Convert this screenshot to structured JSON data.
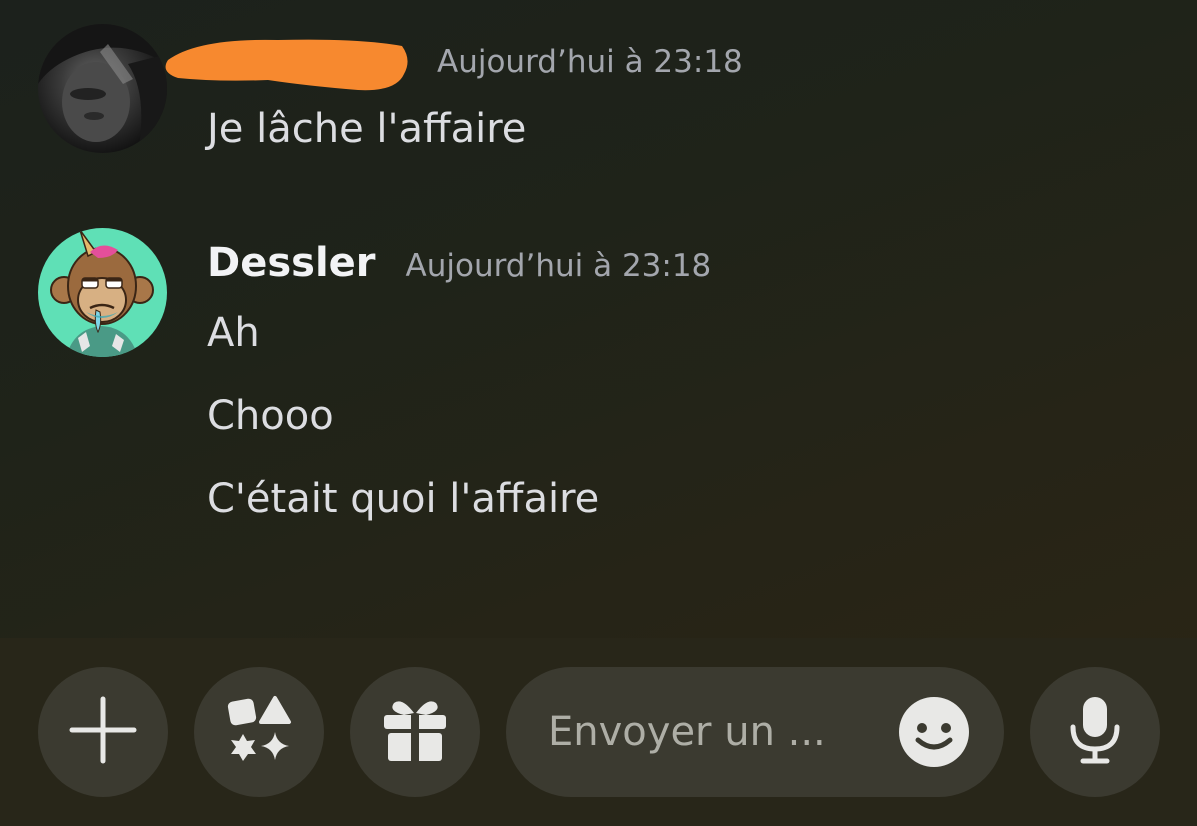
{
  "messages": [
    {
      "author": "",
      "timestamp": "Aujourd’hui à 23:18",
      "lines": [
        "Je lâche l'affaire"
      ]
    },
    {
      "author": "Dessler",
      "timestamp": "Aujourd’hui à 23:18",
      "lines": [
        "Ah",
        "Chooo",
        "C'était quoi l'affaire"
      ]
    }
  ],
  "composer": {
    "placeholder": "Envoyer un ...",
    "buttons": {
      "attach": "plus-icon",
      "apps": "apps-icon",
      "gift": "gift-icon",
      "emoji": "emoji-icon",
      "voice": "microphone-icon"
    }
  },
  "colors": {
    "redaction": "#f7892f",
    "avatar_bg": "#5fe0b6"
  }
}
